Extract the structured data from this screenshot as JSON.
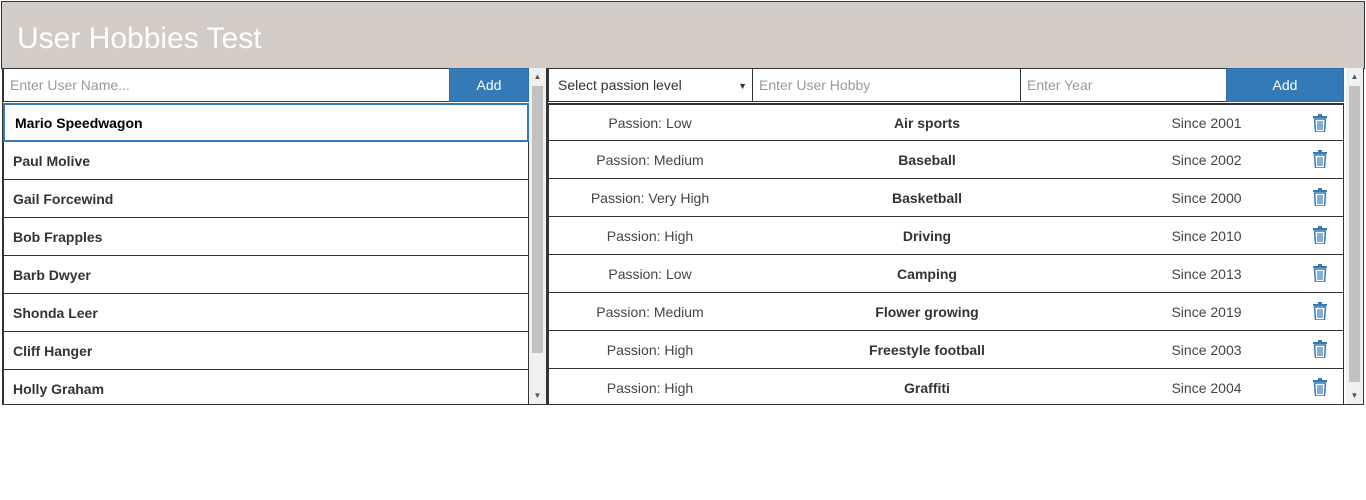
{
  "app": {
    "title": "User Hobbies Test"
  },
  "users_panel": {
    "name_placeholder": "Enter User Name...",
    "add_label": "Add",
    "users": [
      "Mario Speedwagon",
      "Paul Molive",
      "Gail Forcewind",
      "Bob Frapples",
      "Barb Dwyer",
      "Shonda Leer",
      "Cliff Hanger",
      "Holly Graham"
    ],
    "selected_user": "Mario Speedwagon"
  },
  "hobbies_panel": {
    "passion_select_value": "Select passion level",
    "hobby_placeholder": "Enter User Hobby",
    "year_placeholder": "Enter Year",
    "add_label": "Add",
    "hobbies": [
      {
        "passion": "Passion: Low",
        "name": "Air sports",
        "since": "Since 2001"
      },
      {
        "passion": "Passion: Medium",
        "name": "Baseball",
        "since": "Since 2002"
      },
      {
        "passion": "Passion: Very High",
        "name": "Basketball",
        "since": "Since 2000"
      },
      {
        "passion": "Passion: High",
        "name": "Driving",
        "since": "Since 2010"
      },
      {
        "passion": "Passion: Low",
        "name": "Camping",
        "since": "Since 2013"
      },
      {
        "passion": "Passion: Medium",
        "name": "Flower growing",
        "since": "Since 2019"
      },
      {
        "passion": "Passion: High",
        "name": "Freestyle football",
        "since": "Since 2003"
      },
      {
        "passion": "Passion: High",
        "name": "Graffiti",
        "since": "Since 2004"
      }
    ]
  },
  "colors": {
    "header_bg": "#d3cbc6",
    "button_bg": "#337ab7",
    "trash_icon": "#337ab7",
    "selected_border": "#337ab7"
  },
  "icons": {
    "delete": "trash-icon",
    "dropdown": "chevron-down-icon",
    "scroll_up": "scroll-up-arrow-icon",
    "scroll_down": "scroll-down-arrow-icon"
  }
}
